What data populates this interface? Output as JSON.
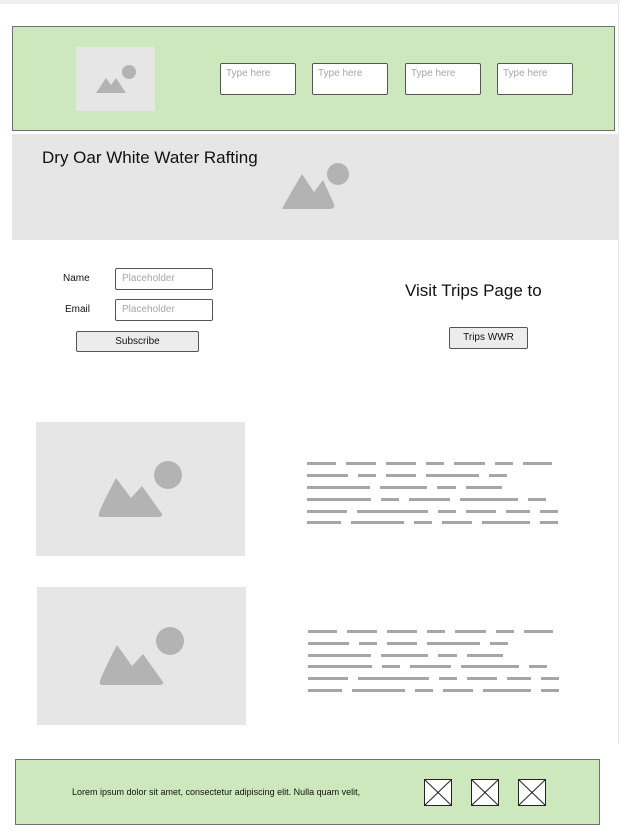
{
  "header": {
    "logo_icon": "image-placeholder-icon",
    "nav_fields": [
      {
        "placeholder": "Type here"
      },
      {
        "placeholder": "Type here"
      },
      {
        "placeholder": "Type here"
      },
      {
        "placeholder": "Type here"
      }
    ]
  },
  "hero": {
    "title": "Dry Oar White Water Rafting",
    "image_icon": "image-placeholder-icon"
  },
  "subscribe": {
    "name_label": "Name",
    "name_placeholder": "Placeholder",
    "email_label": "Email",
    "email_placeholder": "Placeholder",
    "button_label": "Subscribe"
  },
  "trips": {
    "heading": "Visit Trips Page to",
    "button_label": "Trips WWR"
  },
  "content_blocks": [
    {
      "image_icon": "image-placeholder-icon",
      "text_style": "placeholder-text-lines"
    },
    {
      "image_icon": "image-placeholder-icon",
      "text_style": "placeholder-text-lines"
    }
  ],
  "footer": {
    "text": "Lorem ipsum dolor sit amet, consectetur adipiscing elit. Nulla quam velit,",
    "icons": [
      "crossed-box-icon",
      "crossed-box-icon",
      "crossed-box-icon"
    ]
  },
  "colors": {
    "header_bg": "#cde8bd",
    "placeholder_bg": "#e6e6e6",
    "placeholder_shape": "#b3b3b3"
  }
}
